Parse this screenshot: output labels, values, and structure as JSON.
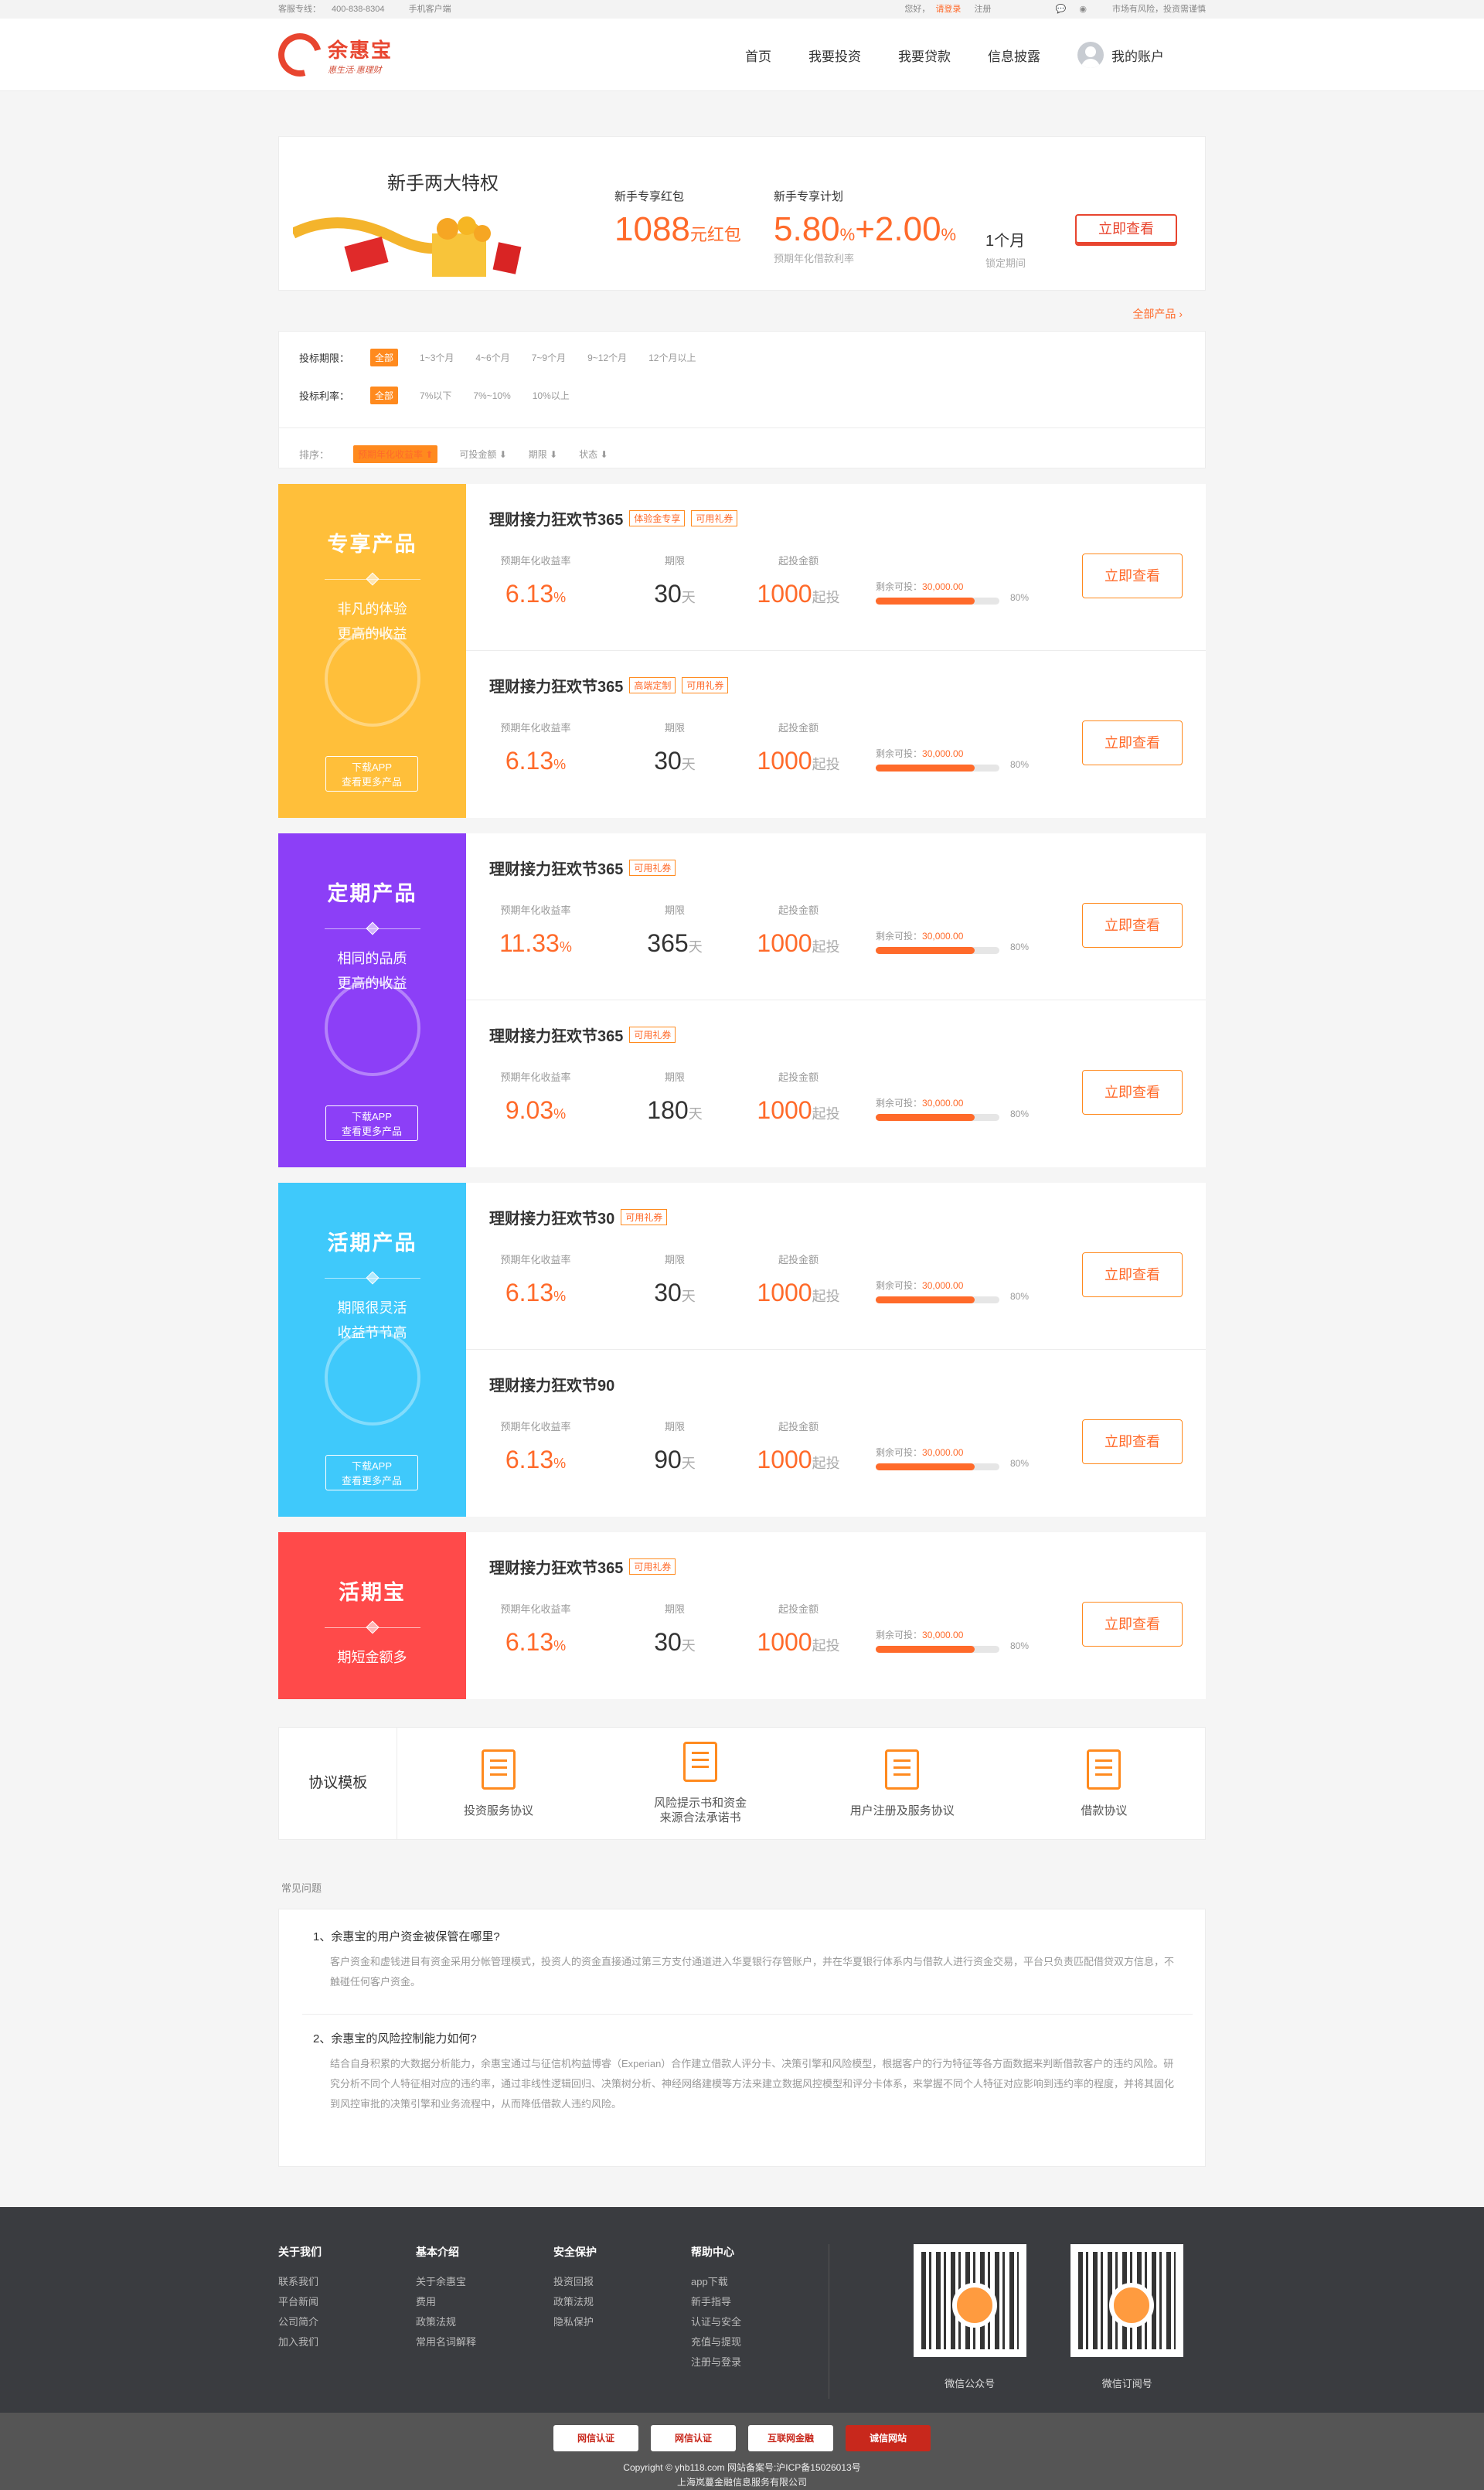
{
  "topbar": {
    "hotline_label": "客服专线：",
    "hotline": "400-838-8304",
    "mobile_client": "手机客户端",
    "greeting": "您好，",
    "login": "请登录",
    "register": "注册",
    "risk": "市场有风险，投资需谨慎"
  },
  "header": {
    "logo_name": "余惠宝",
    "logo_slogan": "惠生活·惠理财",
    "nav": [
      "首页",
      "我要投资",
      "我要贷款",
      "信息披露"
    ],
    "account": "我的账户"
  },
  "promo": {
    "title": "新手两大特权",
    "red_packet_label": "新手专享红包",
    "red_packet_value": "1088",
    "red_packet_unit": "元红包",
    "plan_label": "新手专享计划",
    "plan_rate": "5.80",
    "plan_rate_pct": "%",
    "plan_bonus": "+2.00",
    "plan_bonus_pct": "%",
    "plan_rate_sub": "预期年化借款利率",
    "period": "1个月",
    "period_sub": "锁定期间",
    "button": "立即查看"
  },
  "all_products": "全部产品 ›",
  "filters": {
    "period_label": "投标期限：",
    "period_options": [
      "全部",
      "1~3个月",
      "4~6个月",
      "7~9个月",
      "9~12个月",
      "12个月以上"
    ],
    "rate_label": "投标利率：",
    "rate_options": [
      "全部",
      "7%以下",
      "7%~10%",
      "10%以上"
    ],
    "sort_label": "排序：",
    "sort_options": [
      "预期年化收益率 ⬆",
      "可投金额 ⬇",
      "期限 ⬇",
      "状态 ⬇"
    ]
  },
  "labels": {
    "rate": "预期年化收益率",
    "period": "期限",
    "min": "起投金额",
    "remain": "剩余可投：",
    "qitou": "起投",
    "go": "立即查看"
  },
  "groups": [
    {
      "name": "专享产品",
      "color": "#ffbf3a",
      "desc1": "非凡的体验",
      "desc2": "更高的收益",
      "dl1": "下载APP",
      "dl2": "查看更多产品",
      "items": [
        {
          "title": "理财接力狂欢节365",
          "tags": [
            "体验金专享",
            "可用礼券"
          ],
          "rate": "6.13",
          "rate_unit": "%",
          "period": "30",
          "period_unit": "天",
          "min": "1000",
          "remain": "30,000.00",
          "pct": "80%",
          "progress": 0.8
        },
        {
          "title": "理财接力狂欢节365",
          "tags": [
            "高端定制",
            "可用礼券"
          ],
          "rate": "6.13",
          "rate_unit": "%",
          "period": "30",
          "period_unit": "天",
          "min": "1000",
          "remain": "30,000.00",
          "pct": "80%",
          "progress": 0.8
        }
      ]
    },
    {
      "name": "定期产品",
      "color": "#8c3ff7",
      "desc1": "相同的品质",
      "desc2": "更高的收益",
      "dl1": "下载APP",
      "dl2": "查看更多产品",
      "items": [
        {
          "title": "理财接力狂欢节365",
          "tags": [
            "可用礼券"
          ],
          "rate": "11.33",
          "rate_unit": "%",
          "period": "365",
          "period_unit": "天",
          "min": "1000",
          "remain": "30,000.00",
          "pct": "80%",
          "progress": 0.8
        },
        {
          "title": "理财接力狂欢节365",
          "tags": [
            "可用礼券"
          ],
          "rate": "9.03",
          "rate_unit": "%",
          "period": "180",
          "period_unit": "天",
          "min": "1000",
          "remain": "30,000.00",
          "pct": "80%",
          "progress": 0.8
        }
      ]
    },
    {
      "name": "活期产品",
      "color": "#3fc9fb",
      "desc1": "期限很灵活",
      "desc2": "收益节节高",
      "dl1": "下载APP",
      "dl2": "查看更多产品",
      "items": [
        {
          "title": "理财接力狂欢节30",
          "tags": [
            "可用礼券"
          ],
          "rate": "6.13",
          "rate_unit": "%",
          "period": "30",
          "period_unit": "天",
          "min": "1000",
          "remain": "30,000.00",
          "pct": "80%",
          "progress": 0.8
        },
        {
          "title": "理财接力狂欢节90",
          "tags": [],
          "rate": "6.13",
          "rate_unit": "%",
          "period": "90",
          "period_unit": "天",
          "min": "1000",
          "remain": "30,000.00",
          "pct": "80%",
          "progress": 0.8
        }
      ]
    },
    {
      "name": "活期宝",
      "color": "#ff4a4a",
      "desc1": "期短金额多",
      "desc2": "",
      "dl1": "",
      "dl2": "",
      "items": [
        {
          "title": "理财接力狂欢节365",
          "tags": [
            "可用礼券"
          ],
          "rate": "6.13",
          "rate_unit": "%",
          "period": "30",
          "period_unit": "天",
          "min": "1000",
          "remain": "30,000.00",
          "pct": "80%",
          "progress": 0.8
        }
      ]
    }
  ],
  "agreements": {
    "label": "协议模板",
    "items": [
      "投资服务协议",
      "风险提示书和资金\n来源合法承诺书",
      "用户注册及服务协议",
      "借款协议"
    ]
  },
  "faq": {
    "title": "常见问题",
    "items": [
      {
        "q": "1、余惠宝的用户资金被保管在哪里?",
        "a": "客户资金和虚钱进目有资金采用分帐管理模式，投资人的资金直接通过第三方支付通道进入华夏银行存管账户，并在华夏银行体系内与借款人进行资金交易，平台只负责匹配借贷双方信息，不触碰任何客户资金。"
      },
      {
        "q": "2、余惠宝的风险控制能力如何?",
        "a": "结合自身积累的大数据分析能力，余惠宝通过与征信机构益博睿（Experian）合作建立借款人评分卡、决策引擎和风险模型，根据客户的行为特征等各方面数据来判断借款客户的违约风险。研究分析不同个人特征相对应的违约率，通过非线性逻辑回归、决策树分析、神经网络建模等方法来建立数据风控模型和评分卡体系，来掌握不同个人特征对应影响到违约率的程度，并将其固化到风控审批的决策引擎和业务流程中，从而降低借款人违约风险。"
      }
    ]
  },
  "footer": {
    "cols": [
      {
        "title": "关于我们",
        "links": [
          "联系我们",
          "平台新闻",
          "公司简介",
          "加入我们"
        ]
      },
      {
        "title": "基本介绍",
        "links": [
          "关于余惠宝",
          "费用",
          "政策法规",
          "常用名词解释"
        ]
      },
      {
        "title": "安全保护",
        "links": [
          "投资回报",
          "政策法规",
          "隐私保护"
        ]
      },
      {
        "title": "帮助中心",
        "links": [
          "app下载",
          "新手指导",
          "认证与安全",
          "充值与提现",
          "注册与登录"
        ]
      }
    ],
    "qr1": "微信公众号",
    "qr2": "微信订阅号",
    "badges": [
      "网信认证",
      "网信认证",
      "互联网金融",
      "诚信网站"
    ],
    "copyright": "Copyright © yhb118.com 网站备案号:沪ICP备15026013号",
    "company": "上海岚蔓金融信息服务有限公司"
  }
}
